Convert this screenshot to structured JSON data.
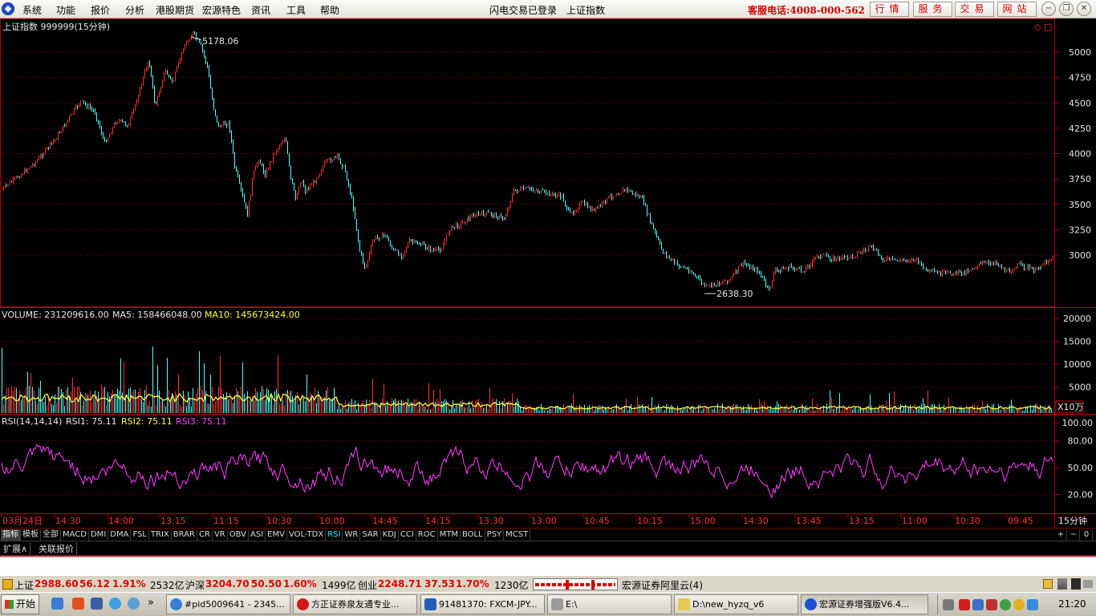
{
  "menubar": {
    "items": [
      "系统",
      "功能",
      "报价",
      "分析",
      "港股期货",
      "宏源特色",
      "资讯",
      "工具",
      "帮助"
    ],
    "center": [
      "闪电交易已登录",
      "上证指数"
    ],
    "hotline": "客服电话:4008-000-562",
    "quick_buttons": [
      "行情",
      "服务",
      "交易",
      "网站"
    ],
    "window_controls": [
      "−",
      "❐",
      "✕"
    ]
  },
  "price_panel": {
    "title": "上证指数 999999(15分钟)",
    "high_label": "5178.06",
    "low_label": "2638.30",
    "y_ticks": [
      "5000",
      "4750",
      "4500",
      "4250",
      "4000",
      "3750",
      "3500",
      "3250",
      "3000"
    ],
    "icons": [
      "◇",
      "□"
    ]
  },
  "volume_panel": {
    "legend": [
      {
        "text": "VOLUME: 231209616.00",
        "color": "#e8e8e8"
      },
      {
        "text": "MA5: 158466048.00",
        "color": "#e8e8e8"
      },
      {
        "text": "MA10: 145673424.00",
        "color": "#ffff40"
      }
    ],
    "y_ticks": [
      "20000",
      "15000",
      "10000",
      "5000"
    ],
    "unit": "X10万"
  },
  "rsi_panel": {
    "legend": [
      {
        "text": "RSI(14,14,14)",
        "color": "#e8e8e8"
      },
      {
        "text": "RSI1: 75.11",
        "color": "#e8e8e8"
      },
      {
        "text": "RSI2: 75.11",
        "color": "#ffff40"
      },
      {
        "text": "RSI3: 75.11",
        "color": "#ff40ff"
      }
    ],
    "y_ticks": [
      "100.00",
      "80.00",
      "50.00",
      "20.00"
    ]
  },
  "time_axis": {
    "labels": [
      "03月24日",
      "14:30",
      "14:00",
      "13:15",
      "11:15",
      "10:30",
      "10:00",
      "14:45",
      "14:15",
      "13:30",
      "13:00",
      "10:45",
      "10:15",
      "15:00",
      "14:30",
      "13:45",
      "13:15",
      "11:00",
      "10:30",
      "09:45"
    ],
    "period": "15分钟"
  },
  "indicator_tabs": {
    "items": [
      "指标",
      "模板",
      "全部",
      "MACD",
      "DMI",
      "DMA",
      "FSL",
      "TRIX",
      "BRAR",
      "CR",
      "VR",
      "OBV",
      "ASI",
      "EMV",
      "VOL-TDX",
      "RSI",
      "WR",
      "SAR",
      "KDJ",
      "CCI",
      "ROC",
      "MTM",
      "BOLL",
      "PSY",
      "MCST"
    ],
    "selected": "指标",
    "highlighted": "RSI",
    "right_controls": [
      "+",
      "−",
      "0"
    ]
  },
  "extension_tabs": [
    "扩展∧",
    "关联报价"
  ],
  "status_bar": {
    "sh_name": "上证",
    "sh_value": "2988.60",
    "sh_change": "56.12",
    "sh_pct": "1.91%",
    "sh_amount": "2532亿",
    "hs_name": "沪深",
    "hs_value": "3204.70",
    "hs_change": "50.50",
    "hs_pct": "1.60%",
    "hs_amount": "1499亿",
    "cy_name": "创业",
    "cy_value": "2248.71",
    "cy_change": "37.53",
    "cy_pct": "1.70%",
    "cy_amount": "1230亿",
    "server": "宏源证券阿里云(4)"
  },
  "taskbar": {
    "start": "开始",
    "quicklaunch_more": "»",
    "tasks": [
      "#pid5009641 - 2345...",
      "方正证券泉友通专业...",
      "91481370: FXCM-JPY...",
      "E:\\",
      "D:\\new_hyzq_v6",
      "宏源证券增强版V6.4..."
    ],
    "clock": "21:20"
  },
  "colors": {
    "up": "#ff3232",
    "down": "#54ffff",
    "ma10": "#ffff40",
    "rsi": "#ff40ff",
    "grid": "#8a0000",
    "axis": "#b00000"
  }
}
